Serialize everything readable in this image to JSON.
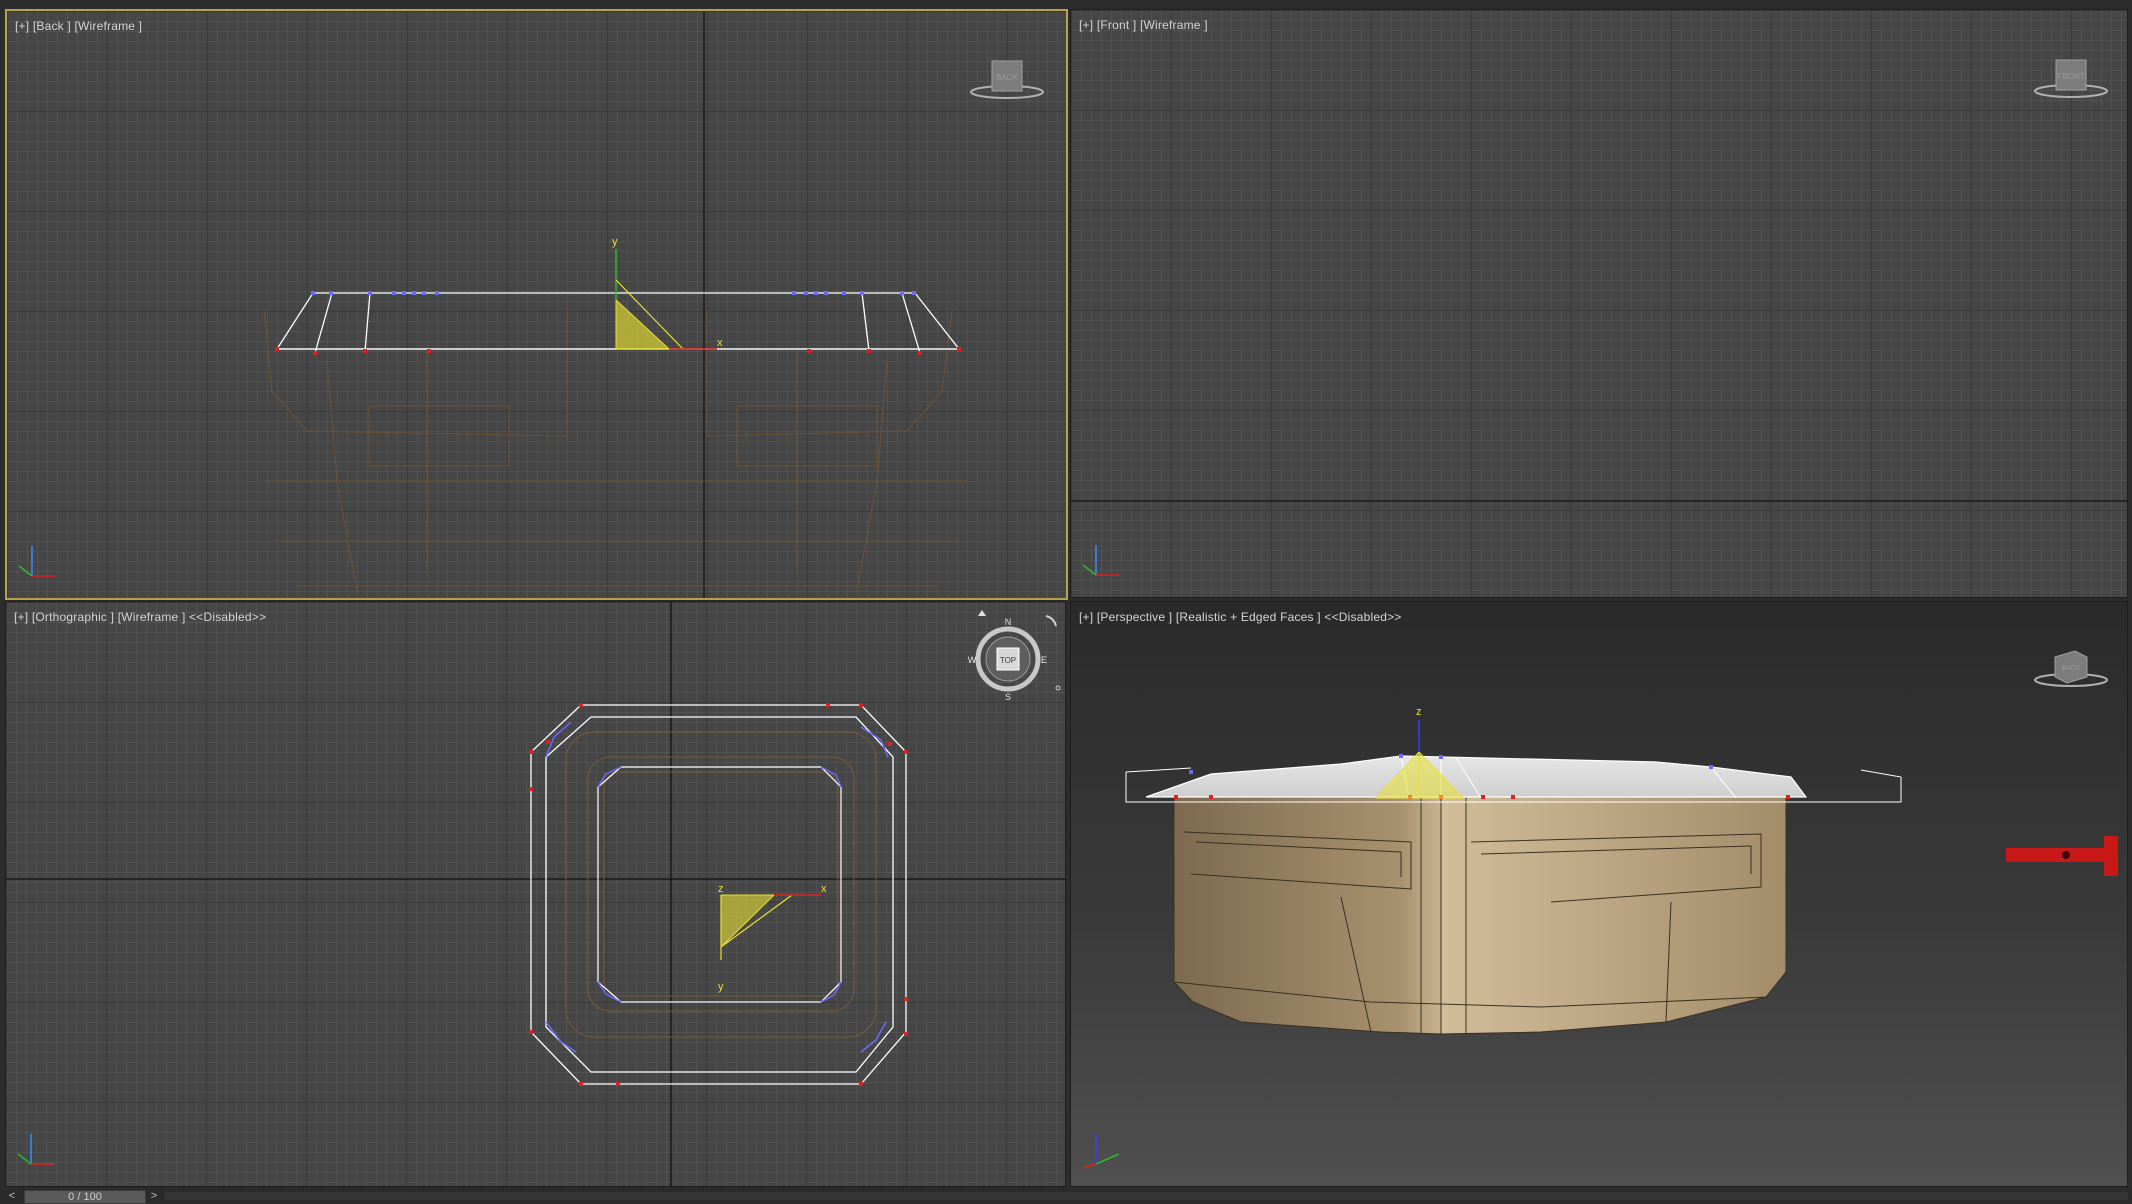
{
  "viewports": {
    "back": {
      "label_plus": "[+]",
      "label_view": "[Back ]",
      "label_mode": "[Wireframe ]",
      "cube_text": "BACK"
    },
    "front": {
      "label_plus": "[+]",
      "label_view": "[Front ]",
      "label_mode": "[Wireframe ]",
      "cube_text": "FRONT"
    },
    "ortho": {
      "label_plus": "[+]",
      "label_view": "[Orthographic ]",
      "label_mode": "[Wireframe ]",
      "label_extra": "<<Disabled>>",
      "compass_face": "TOP",
      "compass_n": "N",
      "compass_s": "S",
      "compass_w": "W",
      "compass_e": "E"
    },
    "persp": {
      "label_plus": "[+]",
      "label_view": "[Perspective ]",
      "label_mode": "[Realistic + Edged Faces ]",
      "label_extra": "<<Disabled>>",
      "cube_text": "BACK"
    }
  },
  "gizmo": {
    "x": "x",
    "y": "y",
    "z": "z"
  },
  "timeline": {
    "prev": "<",
    "frame": "0 / 100",
    "next": ">"
  },
  "colors": {
    "active_border": "#b8a24e",
    "wire_white": "#ffffff",
    "wire_brown": "#7a5a38",
    "vertex_red": "#e02020",
    "vertex_blue": "#6a6aff",
    "gizmo_yellow": "#e8e030",
    "mesh_tan": "#a8916e"
  }
}
